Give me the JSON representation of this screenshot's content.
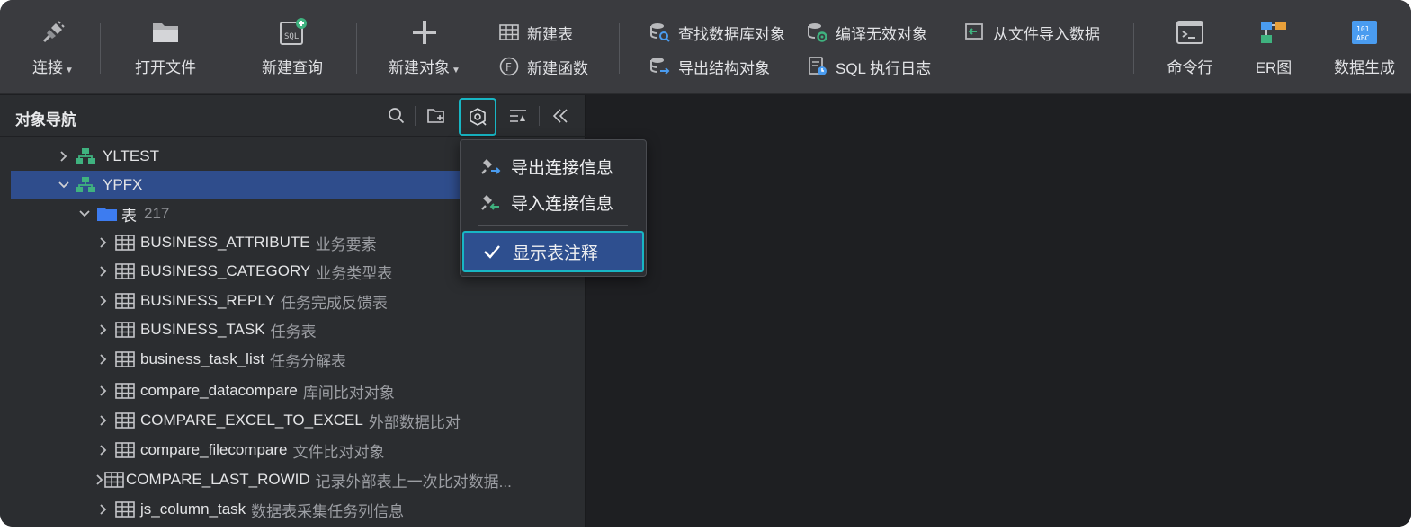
{
  "toolbar": {
    "connect": "连接",
    "open_file": "打开文件",
    "new_query": "新建查询",
    "new_object": "新建对象",
    "new_table": "新建表",
    "new_function": "新建函数",
    "find_db_object": "查找数据库对象",
    "export_structure": "导出结构对象",
    "compile_invalid": "编译无效对象",
    "sql_log": "SQL 执行日志",
    "import_from_file": "从文件导入数据",
    "command_line": "命令行",
    "er_diagram": "ER图",
    "data_gen": "数据生成"
  },
  "navigator": {
    "title": "对象导航",
    "connections": [
      {
        "name": "YLTEST"
      },
      {
        "name": "YPFX"
      }
    ],
    "folder": {
      "name": "表",
      "count": "217"
    },
    "tables": [
      {
        "name": "BUSINESS_ATTRIBUTE",
        "comment": "业务要素"
      },
      {
        "name": "BUSINESS_CATEGORY",
        "comment": "业务类型表"
      },
      {
        "name": "BUSINESS_REPLY",
        "comment": "任务完成反馈表"
      },
      {
        "name": "BUSINESS_TASK",
        "comment": "任务表"
      },
      {
        "name": "business_task_list",
        "comment": "任务分解表"
      },
      {
        "name": "compare_datacompare",
        "comment": "库间比对对象"
      },
      {
        "name": "COMPARE_EXCEL_TO_EXCEL",
        "comment": "外部数据比对"
      },
      {
        "name": "compare_filecompare",
        "comment": "文件比对对象"
      },
      {
        "name": "COMPARE_LAST_ROWID",
        "comment": "记录外部表上一次比对数据..."
      },
      {
        "name": "js_column_task",
        "comment": "数据表采集任务列信息"
      }
    ]
  },
  "menu": {
    "export_conn": "导出连接信息",
    "import_conn": "导入连接信息",
    "show_comment": "显示表注释"
  },
  "colors": {
    "accent": "#18b6c4",
    "selection": "#2f4d8c",
    "folder": "#3d7cf0",
    "connection": "#3fb27f"
  }
}
